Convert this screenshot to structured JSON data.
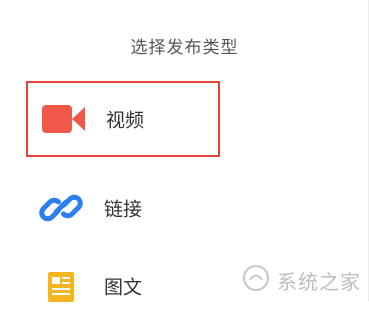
{
  "dialog": {
    "title": "选择发布类型",
    "options": [
      {
        "label": "视频",
        "icon": "video-camera-icon",
        "selected": true,
        "color": "#f0584a"
      },
      {
        "label": "链接",
        "icon": "link-icon",
        "selected": false,
        "color": "#2b7ff2"
      },
      {
        "label": "图文",
        "icon": "article-icon",
        "selected": false,
        "color": "#f5b51f"
      }
    ]
  },
  "watermark": {
    "text": "系统之家"
  },
  "colors": {
    "accent": "#e5443a",
    "link": "#2b7ff2",
    "article": "#f5b51f"
  }
}
